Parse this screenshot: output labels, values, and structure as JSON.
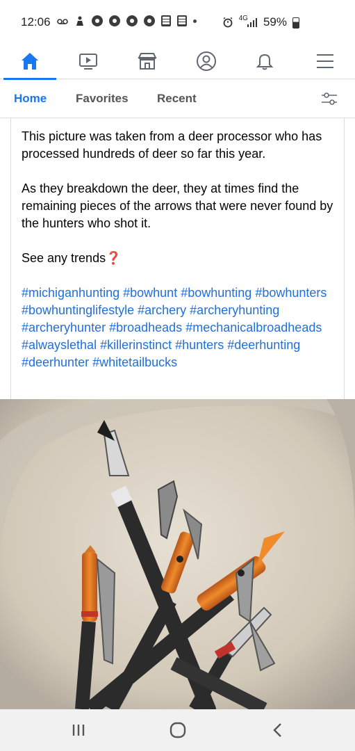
{
  "status_bar": {
    "time": "12:06",
    "signal_text": "4G",
    "battery_percent": "59%"
  },
  "top_nav": {
    "items": [
      {
        "icon": "home-icon",
        "active": true
      },
      {
        "icon": "watch-video-icon",
        "active": false
      },
      {
        "icon": "marketplace-icon",
        "active": false
      },
      {
        "icon": "profile-icon",
        "active": false
      },
      {
        "icon": "notifications-bell-icon",
        "active": false
      },
      {
        "icon": "menu-icon",
        "active": false
      }
    ],
    "accent": "#1877f2"
  },
  "sub_tabs": {
    "home": "Home",
    "favorites": "Favorites",
    "recent": "Recent"
  },
  "post": {
    "para1": "This picture was taken from a deer processor who has processed hundreds of deer so far this year.",
    "para2": "As they breakdown the deer, they at times find the remaining pieces of the arrows that were never found by the hunters who shot it.",
    "para3": "See any trends",
    "question_emoji": "❓",
    "hashtags": [
      "#michiganhunting",
      "#bowhunt",
      "#bowhunting",
      "#bowhunters",
      "#bowhuntinglifestyle",
      "#archery",
      "#archeryhunting",
      "#archeryhunter",
      "#broadheads",
      "#mechanicalbroadheads",
      "#alwayslethal",
      "#killerinstinct",
      "#hunters",
      "#deerhunting",
      "#deerhunter",
      "#whitetailbucks"
    ],
    "hashtag_color": "#216fdb"
  },
  "photo": {
    "subject": "broken arrows with broadheads in a plastic container"
  },
  "android_nav": {
    "items": [
      "recent-apps-icon",
      "home-circle-icon",
      "back-icon"
    ]
  }
}
